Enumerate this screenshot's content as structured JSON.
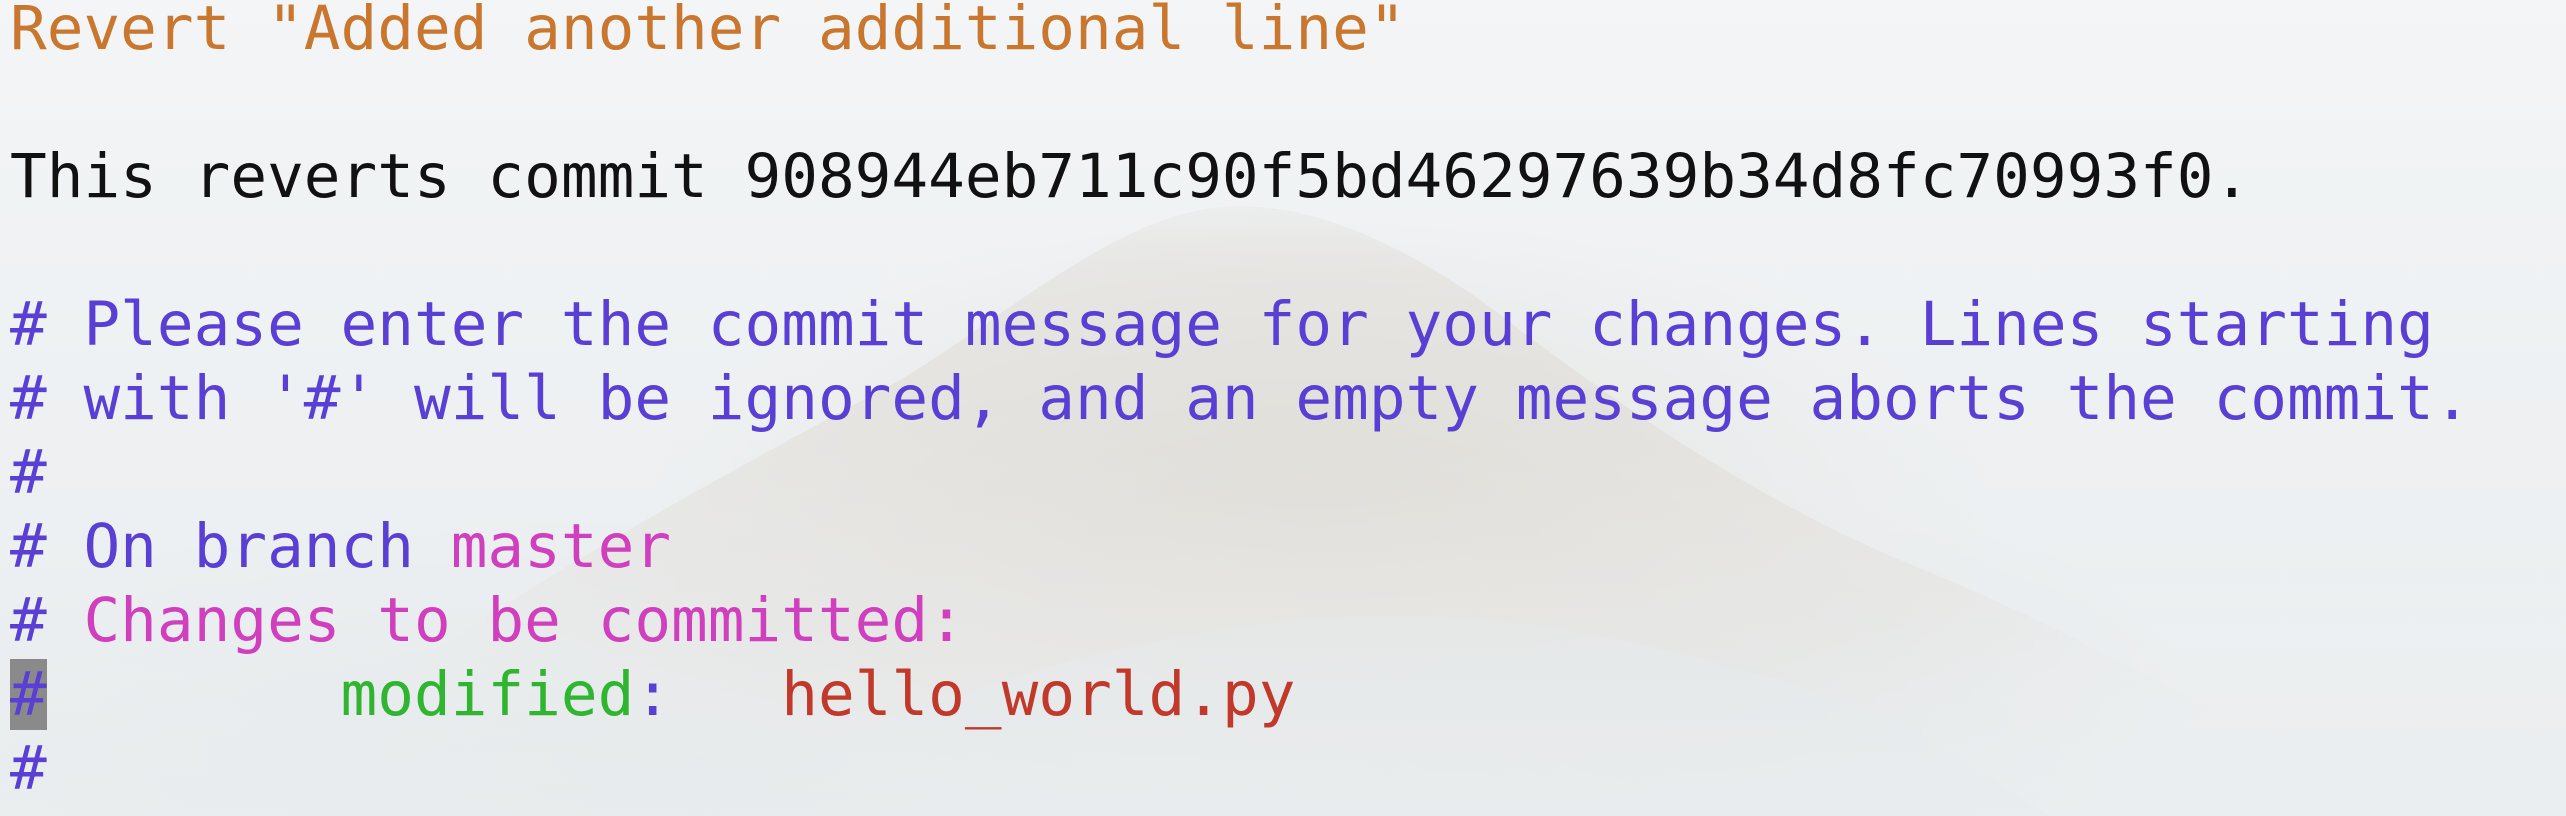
{
  "editor": {
    "subject_line": "Revert \"Added another additional line\"",
    "body_line": "This reverts commit 908944eb711c90f5bd46297639b34d8fc70993f0.",
    "comment_lines": [
      "# Please enter the commit message for your changes. Lines starting",
      "# with '#' will be ignored, and an empty message aborts the commit.",
      "#"
    ],
    "branch_line": {
      "prefix": "# On branch ",
      "branch": "master"
    },
    "changes_line": {
      "hash": "# ",
      "label": "Changes to be committed:"
    },
    "modified_line": {
      "cursor": "#",
      "indent": "        ",
      "status": "modified",
      "colon": ":",
      "gap": "   ",
      "file": "hello_world.py"
    },
    "final_comment": "#"
  },
  "colors": {
    "subject": "#c9772e",
    "comment": "#5a3fd4",
    "branch": "#cf3fbe",
    "modified": "#2fb52f",
    "filename": "#c0392b"
  }
}
